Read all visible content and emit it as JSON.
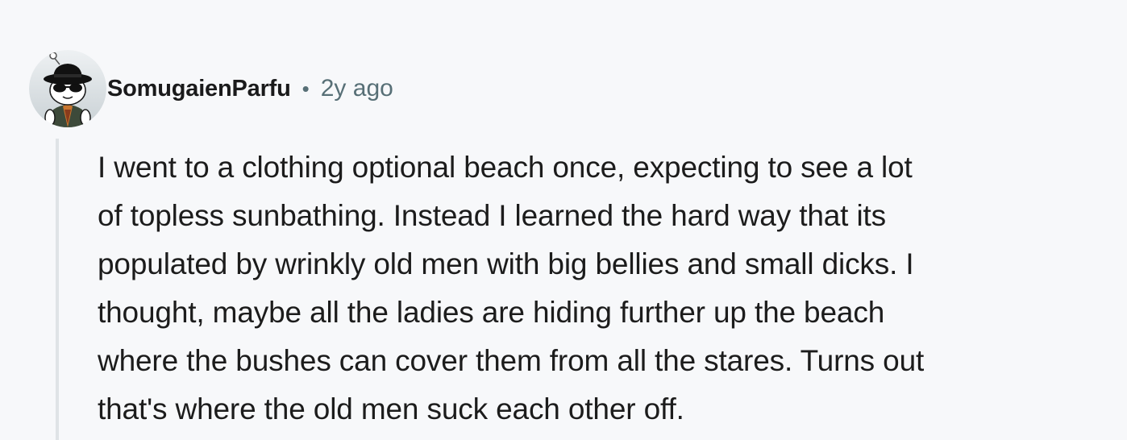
{
  "comment": {
    "author": "SomugaienParfu",
    "separator": "•",
    "timestamp": "2y ago",
    "avatar_icon": "snoo-avatar-icon",
    "body_lines": [
      "I went to a clothing optional beach once, expecting to see a lot",
      "of topless sunbathing. Instead I learned the hard way that its",
      "populated by wrinkly old men with big bellies and small dicks. I",
      "thought, maybe all the ladies are hiding further up the beach",
      "where the bushes can cover them from all the stares. Turns out",
      "that's where the old men suck each other off."
    ]
  },
  "colors": {
    "background": "#f7f8fa",
    "text": "#1c1c1c",
    "meta": "#576f76",
    "thread_line": "#dfe3e6"
  }
}
